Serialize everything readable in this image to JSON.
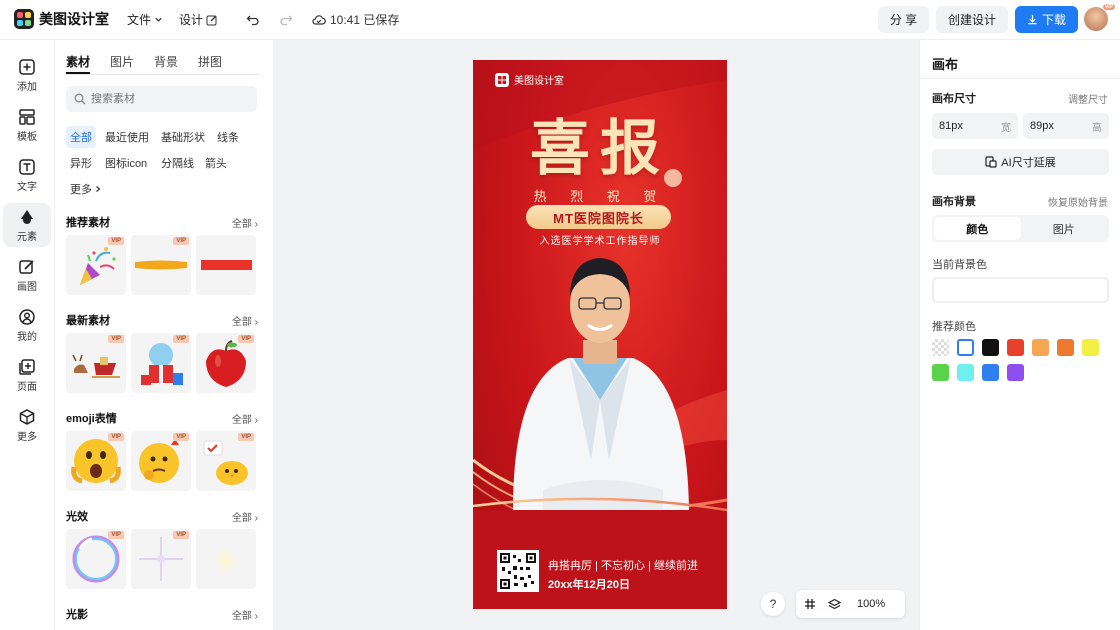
{
  "app": {
    "name": "美图设计室"
  },
  "topbar": {
    "file_menu": "文件",
    "design_menu": "设计",
    "saved_status": "10:41 已保存",
    "share": "分 享",
    "create": "创建设计",
    "download": "下载",
    "vip_badge": "VIP"
  },
  "leftnav": [
    {
      "label": "添加",
      "icon": "plus-square-icon"
    },
    {
      "label": "模板",
      "icon": "template-icon"
    },
    {
      "label": "文字",
      "icon": "text-icon"
    },
    {
      "label": "元素",
      "icon": "shapes-icon",
      "active": true
    },
    {
      "label": "画图",
      "icon": "pen-icon"
    },
    {
      "label": "我的",
      "icon": "user-icon"
    },
    {
      "label": "页面",
      "icon": "page-add-icon"
    },
    {
      "label": "更多",
      "icon": "cube-icon"
    }
  ],
  "panel": {
    "tabs": [
      "素材",
      "图片",
      "背景",
      "拼图"
    ],
    "search_placeholder": "搜索素材",
    "chips": [
      "全部",
      "最近使用",
      "基础形状",
      "线条",
      "异形",
      "图标icon",
      "分隔线",
      "箭头",
      "更多"
    ],
    "all_label": "全部",
    "vip_label": "VIP",
    "sections": [
      {
        "title": "推荐素材",
        "items": [
          "party-popper",
          "yellow-brush-stroke",
          "red-bar"
        ]
      },
      {
        "title": "最新素材",
        "items": [
          "reindeer-sleigh",
          "snow-globe-gift",
          "red-apple"
        ]
      },
      {
        "title": "emoji表情",
        "items": [
          "shocked-emoji",
          "thinking-emoji",
          "chick-emoji"
        ]
      },
      {
        "title": "光效",
        "items": [
          "bubble-ring",
          "light-sparkle",
          "soft-glow"
        ]
      },
      {
        "title": "光影",
        "items": []
      }
    ]
  },
  "poster": {
    "brand": "美图设计室",
    "title": "喜报",
    "subtitle": "热 烈 祝 贺",
    "name_pill": "MT医院图院长",
    "role": "入选医学学术工作指导师",
    "slogan": "冉搭冉厉 | 不忘初心 | 继续前进",
    "date": "20xx年12月20日"
  },
  "canvas_tools": {
    "help": "?",
    "zoom": "100%"
  },
  "right_panel": {
    "title": "画布",
    "size_label": "画布尺寸",
    "adjust_size": "调整尺寸",
    "width_value": "81px",
    "width_unit": "宽",
    "height_value": "89px",
    "height_unit": "高",
    "ai_extend": "AI尺寸延展",
    "bg_label": "画布背景",
    "restore_bg": "恢复原始背景",
    "seg_color": "颜色",
    "seg_image": "图片",
    "current_bg": "当前背景色",
    "recommended": "推荐颜色",
    "swatches": [
      "transparent",
      "#ffffff",
      "#111111",
      "#e8402b",
      "#f5a653",
      "#ee7a2e",
      "#f4ef43",
      "#5ad24a",
      "#6ff0ee",
      "#2f7ff0",
      "#8f4ef0"
    ]
  }
}
